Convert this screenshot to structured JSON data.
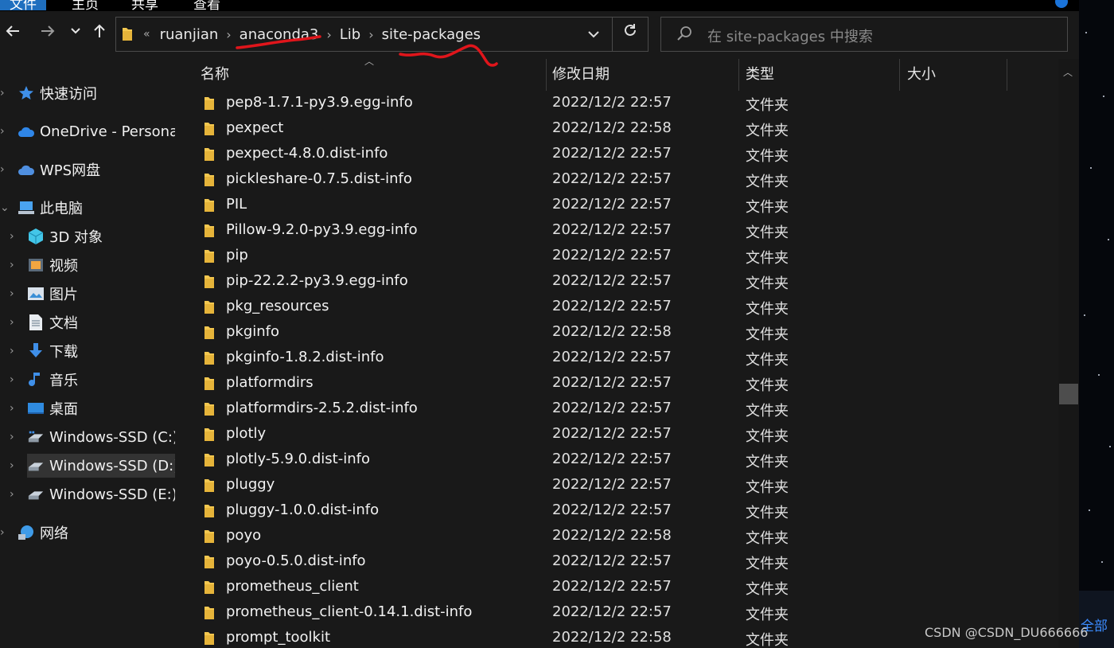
{
  "ribbon": {
    "tabs": [
      "文件",
      "主页",
      "共享",
      "查看"
    ]
  },
  "nav": {
    "back_icon": "arrow-left-icon",
    "forward_icon": "arrow-right-icon",
    "recent_icon": "chevron-down-icon",
    "up_icon": "arrow-up-icon"
  },
  "address": {
    "overflow": "«",
    "crumbs": [
      "ruanjian",
      "anaconda3",
      "Lib",
      "site-packages"
    ],
    "separator": "›"
  },
  "search": {
    "placeholder": "在 site-packages 中搜索"
  },
  "sidebar": {
    "items": [
      {
        "label": "快速访问",
        "icon": "star-icon"
      },
      {
        "label": "OneDrive - Personal",
        "icon": "cloud-icon"
      },
      {
        "label": "WPS网盘",
        "icon": "cloud-icon"
      },
      {
        "label": "此电脑",
        "icon": "computer-icon"
      },
      {
        "label": "3D 对象",
        "icon": "cube-icon"
      },
      {
        "label": "视频",
        "icon": "video-icon"
      },
      {
        "label": "图片",
        "icon": "picture-icon"
      },
      {
        "label": "文档",
        "icon": "document-icon"
      },
      {
        "label": "下载",
        "icon": "download-icon"
      },
      {
        "label": "音乐",
        "icon": "music-icon"
      },
      {
        "label": "桌面",
        "icon": "desktop-icon"
      },
      {
        "label": "Windows-SSD (C:)",
        "icon": "drive-icon"
      },
      {
        "label": "Windows-SSD (D:)",
        "icon": "drive-icon"
      },
      {
        "label": "Windows-SSD (E:)",
        "icon": "drive-icon"
      },
      {
        "label": "网络",
        "icon": "network-icon"
      }
    ]
  },
  "columns": {
    "name": "名称",
    "modified": "修改日期",
    "type": "类型",
    "size": "大小"
  },
  "files": [
    {
      "name": "pep8-1.7.1-py3.9.egg-info",
      "modified": "2022/12/2 22:57",
      "type": "文件夹"
    },
    {
      "name": "pexpect",
      "modified": "2022/12/2 22:58",
      "type": "文件夹"
    },
    {
      "name": "pexpect-4.8.0.dist-info",
      "modified": "2022/12/2 22:57",
      "type": "文件夹"
    },
    {
      "name": "pickleshare-0.7.5.dist-info",
      "modified": "2022/12/2 22:57",
      "type": "文件夹"
    },
    {
      "name": "PIL",
      "modified": "2022/12/2 22:57",
      "type": "文件夹"
    },
    {
      "name": "Pillow-9.2.0-py3.9.egg-info",
      "modified": "2022/12/2 22:57",
      "type": "文件夹"
    },
    {
      "name": "pip",
      "modified": "2022/12/2 22:57",
      "type": "文件夹"
    },
    {
      "name": "pip-22.2.2-py3.9.egg-info",
      "modified": "2022/12/2 22:57",
      "type": "文件夹"
    },
    {
      "name": "pkg_resources",
      "modified": "2022/12/2 22:57",
      "type": "文件夹"
    },
    {
      "name": "pkginfo",
      "modified": "2022/12/2 22:58",
      "type": "文件夹"
    },
    {
      "name": "pkginfo-1.8.2.dist-info",
      "modified": "2022/12/2 22:57",
      "type": "文件夹"
    },
    {
      "name": "platformdirs",
      "modified": "2022/12/2 22:57",
      "type": "文件夹"
    },
    {
      "name": "platformdirs-2.5.2.dist-info",
      "modified": "2022/12/2 22:57",
      "type": "文件夹"
    },
    {
      "name": "plotly",
      "modified": "2022/12/2 22:57",
      "type": "文件夹"
    },
    {
      "name": "plotly-5.9.0.dist-info",
      "modified": "2022/12/2 22:57",
      "type": "文件夹"
    },
    {
      "name": "pluggy",
      "modified": "2022/12/2 22:57",
      "type": "文件夹"
    },
    {
      "name": "pluggy-1.0.0.dist-info",
      "modified": "2022/12/2 22:57",
      "type": "文件夹"
    },
    {
      "name": "poyo",
      "modified": "2022/12/2 22:58",
      "type": "文件夹"
    },
    {
      "name": "poyo-0.5.0.dist-info",
      "modified": "2022/12/2 22:57",
      "type": "文件夹"
    },
    {
      "name": "prometheus_client",
      "modified": "2022/12/2 22:57",
      "type": "文件夹"
    },
    {
      "name": "prometheus_client-0.14.1.dist-info",
      "modified": "2022/12/2 22:57",
      "type": "文件夹"
    },
    {
      "name": "prompt_toolkit",
      "modified": "2022/12/2 22:58",
      "type": "文件夹"
    }
  ],
  "desktop_edge_text": "全部",
  "watermark": "CSDN @CSDN_DU666666",
  "colors": {
    "annotation": "#e0151b",
    "folder": "#f3c74f",
    "accent": "#1a73d9"
  }
}
